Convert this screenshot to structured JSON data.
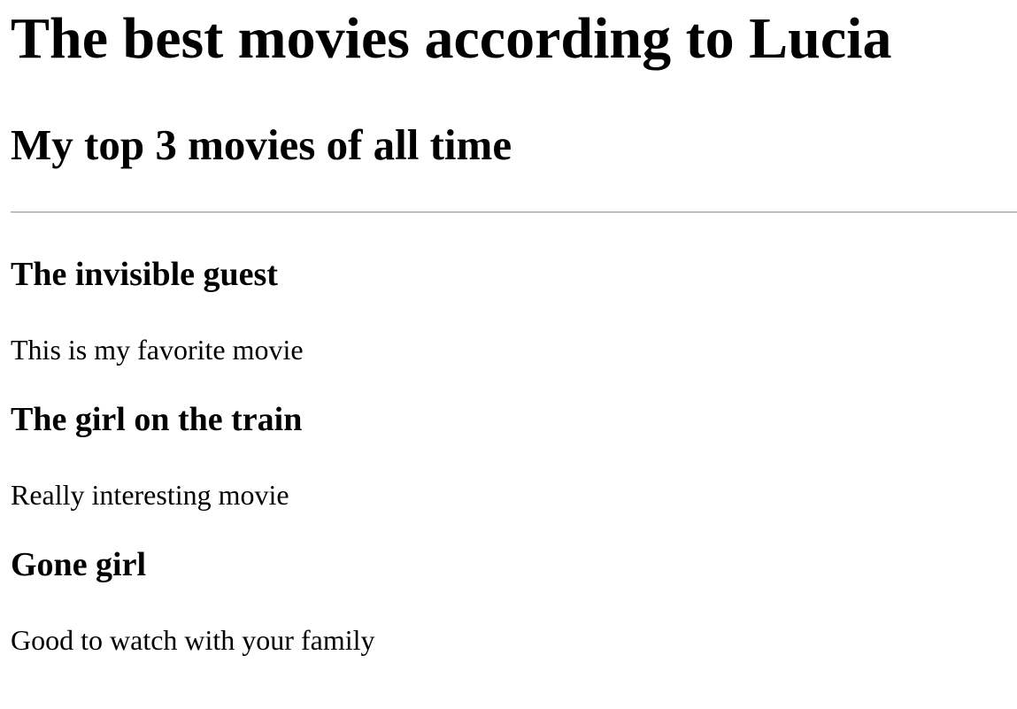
{
  "page": {
    "title": "The best movies according to Lucia",
    "subtitle": "My top 3 movies of all time"
  },
  "movies": [
    {
      "title": "The invisible guest",
      "description": "This is my favorite movie"
    },
    {
      "title": "The girl on the train",
      "description": "Really interesting movie"
    },
    {
      "title": "Gone girl",
      "description": "Good to watch with your family"
    }
  ]
}
